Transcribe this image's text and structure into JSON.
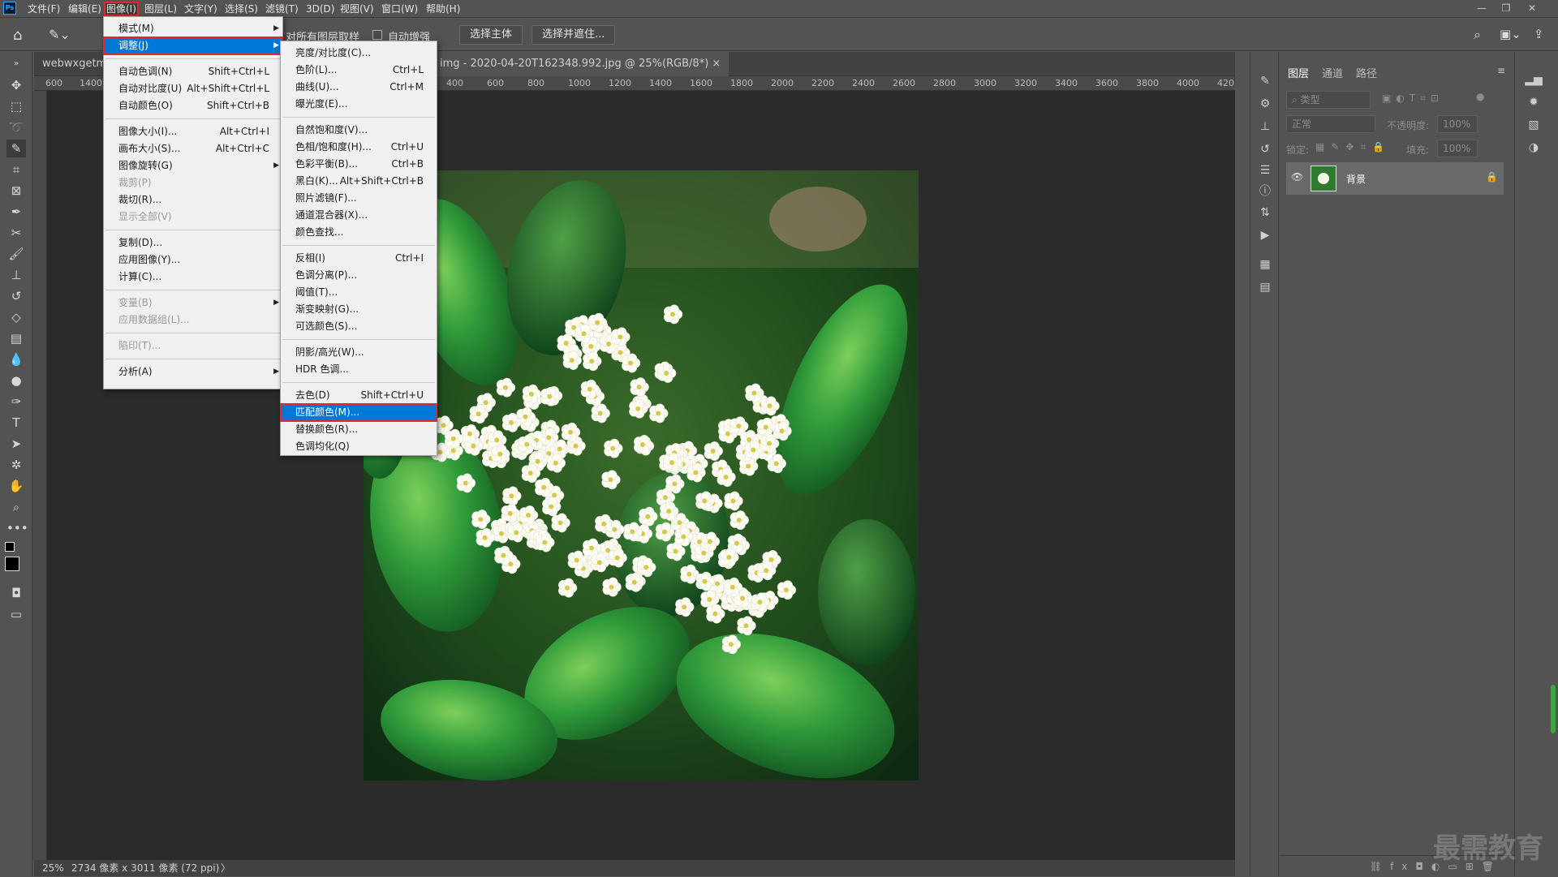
{
  "app": {
    "logo": "Ps"
  },
  "menubar": {
    "items": [
      "文件(F)",
      "编辑(E)",
      "图像(I)",
      "图层(L)",
      "文字(Y)",
      "选择(S)",
      "滤镜(T)",
      "3D(D)",
      "视图(V)",
      "窗口(W)",
      "帮助(H)"
    ],
    "active": "图像(I)"
  },
  "options": {
    "sample_all_layers": "对所有图层取样",
    "auto_enhance": "自动增强",
    "select_subject": "选择主体",
    "select_and_mask": "选择并遮住..."
  },
  "document": {
    "tab_left": "webwxgetms",
    "tab_main": "img - 2020-04-20T162348.992.jpg @ 25%(RGB/8*)",
    "close_glyph": "×"
  },
  "rulers": {
    "h_left": [
      "600",
      "1400"
    ],
    "h_right": [
      "400",
      "600",
      "800",
      "1000",
      "1200",
      "1400",
      "1600",
      "1800",
      "2000",
      "2200",
      "2400",
      "2600",
      "2800",
      "3000",
      "3200",
      "3400",
      "3600",
      "3800",
      "4000",
      "420"
    ]
  },
  "status": {
    "zoom": "25%",
    "info": "2734 像素 x 3011 像素 (72 ppi)",
    "arrow": "〉"
  },
  "image_menu": {
    "items": [
      {
        "label": "模式(M)",
        "shortcut": "",
        "submenu": true,
        "disabled": false
      },
      {
        "label": "调整(J)",
        "shortcut": "",
        "submenu": true,
        "disabled": false,
        "highlighted": true
      },
      {
        "label": "自动色调(N)",
        "shortcut": "Shift+Ctrl+L",
        "disabled": false
      },
      {
        "label": "自动对比度(U)",
        "shortcut": "Alt+Shift+Ctrl+L",
        "disabled": false
      },
      {
        "label": "自动颜色(O)",
        "shortcut": "Shift+Ctrl+B",
        "disabled": false
      },
      {
        "label": "图像大小(I)...",
        "shortcut": "Alt+Ctrl+I",
        "disabled": false
      },
      {
        "label": "画布大小(S)...",
        "shortcut": "Alt+Ctrl+C",
        "disabled": false
      },
      {
        "label": "图像旋转(G)",
        "shortcut": "",
        "submenu": true,
        "disabled": false
      },
      {
        "label": "裁剪(P)",
        "shortcut": "",
        "disabled": true
      },
      {
        "label": "裁切(R)...",
        "shortcut": "",
        "disabled": false
      },
      {
        "label": "显示全部(V)",
        "shortcut": "",
        "disabled": true
      },
      {
        "label": "复制(D)...",
        "shortcut": "",
        "disabled": false
      },
      {
        "label": "应用图像(Y)...",
        "shortcut": "",
        "disabled": false
      },
      {
        "label": "计算(C)...",
        "shortcut": "",
        "disabled": false
      },
      {
        "label": "变量(B)",
        "shortcut": "",
        "submenu": true,
        "disabled": true
      },
      {
        "label": "应用数据组(L)...",
        "shortcut": "",
        "disabled": true
      },
      {
        "label": "陷印(T)...",
        "shortcut": "",
        "disabled": true
      },
      {
        "label": "分析(A)",
        "shortcut": "",
        "submenu": true,
        "disabled": false
      }
    ]
  },
  "adjust_menu": {
    "items": [
      {
        "label": "亮度/对比度(C)...",
        "shortcut": ""
      },
      {
        "label": "色阶(L)...",
        "shortcut": "Ctrl+L"
      },
      {
        "label": "曲线(U)...",
        "shortcut": "Ctrl+M"
      },
      {
        "label": "曝光度(E)...",
        "shortcut": ""
      },
      {
        "label": "自然饱和度(V)...",
        "shortcut": ""
      },
      {
        "label": "色相/饱和度(H)...",
        "shortcut": "Ctrl+U"
      },
      {
        "label": "色彩平衡(B)...",
        "shortcut": "Ctrl+B"
      },
      {
        "label": "黑白(K)...",
        "shortcut": "Alt+Shift+Ctrl+B"
      },
      {
        "label": "照片滤镜(F)...",
        "shortcut": ""
      },
      {
        "label": "通道混合器(X)...",
        "shortcut": ""
      },
      {
        "label": "颜色查找...",
        "shortcut": ""
      },
      {
        "label": "反相(I)",
        "shortcut": "Ctrl+I"
      },
      {
        "label": "色调分离(P)...",
        "shortcut": ""
      },
      {
        "label": "阈值(T)...",
        "shortcut": ""
      },
      {
        "label": "渐变映射(G)...",
        "shortcut": ""
      },
      {
        "label": "可选颜色(S)...",
        "shortcut": ""
      },
      {
        "label": "阴影/高光(W)...",
        "shortcut": ""
      },
      {
        "label": "HDR 色调...",
        "shortcut": ""
      },
      {
        "label": "去色(D)",
        "shortcut": "Shift+Ctrl+U"
      },
      {
        "label": "匹配颜色(M)...",
        "shortcut": "",
        "highlighted": true
      },
      {
        "label": "替换颜色(R)...",
        "shortcut": ""
      },
      {
        "label": "色调均化(Q)",
        "shortcut": ""
      }
    ]
  },
  "layers_panel": {
    "tabs": [
      "图层",
      "通道",
      "路径"
    ],
    "active_tab": "图层",
    "filter_placeholder": "类型",
    "blend_mode": "正常",
    "opacity_label": "不透明度:",
    "opacity_value": "100%",
    "lock_label": "锁定:",
    "fill_label": "填充:",
    "fill_value": "100%",
    "layer_name": "背景"
  },
  "watermark": "最需教育",
  "colors": {
    "accent_blue": "#0078d7",
    "highlight_red": "#e0282e"
  }
}
